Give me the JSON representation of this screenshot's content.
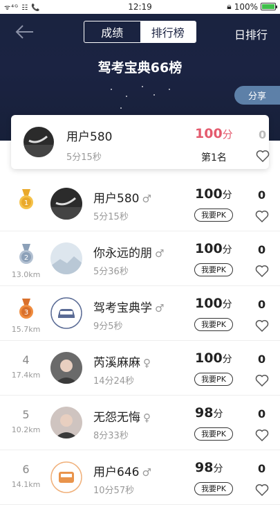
{
  "status_bar": {
    "left": "ᯤ⁴ᴳ ☷ 📞",
    "time": "12:19",
    "battery": "100%"
  },
  "header": {
    "tabs": [
      "成绩",
      "排行榜"
    ],
    "active_tab": 1,
    "daily_label": "日排行"
  },
  "hero": {
    "title": "驾考宝典66榜",
    "share_label": "分享"
  },
  "my_card": {
    "name": "用户580",
    "time": "5分15秒",
    "score": "100",
    "score_unit": "分",
    "rank": "第1名",
    "likes": "0"
  },
  "rows": [
    {
      "rank": "",
      "medal": "gold",
      "distance": "",
      "name": "用户580",
      "sex": "♂",
      "time": "5分15秒",
      "score": "100",
      "unit": "分",
      "pk": "我要PK",
      "likes": "0",
      "avatar": "dark-photo"
    },
    {
      "rank": "",
      "medal": "silver",
      "distance": "13.0km",
      "name": "你永远的朋",
      "sex": "♂",
      "time": "5分36秒",
      "score": "100",
      "unit": "分",
      "pk": "我要PK",
      "likes": "0",
      "avatar": "snow"
    },
    {
      "rank": "",
      "medal": "bronze",
      "distance": "15.7km",
      "name": "驾考宝典学",
      "sex": "♂",
      "time": "9分5秒",
      "score": "100",
      "unit": "分",
      "pk": "我要PK",
      "likes": "0",
      "avatar": "car"
    },
    {
      "rank": "4",
      "medal": "",
      "distance": "17.4km",
      "name": "芮溪麻麻",
      "sex": "♀",
      "time": "14分24秒",
      "score": "100",
      "unit": "分",
      "pk": "我要PK",
      "likes": "0",
      "avatar": "portrait"
    },
    {
      "rank": "5",
      "medal": "",
      "distance": "10.2km",
      "name": "无怨无悔",
      "sex": "♀",
      "time": "8分33秒",
      "score": "98",
      "unit": "分",
      "pk": "我要PK",
      "likes": "0",
      "avatar": "portrait2"
    },
    {
      "rank": "6",
      "medal": "",
      "distance": "14.1km",
      "name": "用户646",
      "sex": "♂",
      "time": "10分57秒",
      "score": "98",
      "unit": "分",
      "pk": "我要PK",
      "likes": "0",
      "avatar": "car-orange"
    }
  ],
  "colors": {
    "header_bg": "#1b2342",
    "score_red": "#e45b6e",
    "share_btn": "#5d80a8"
  }
}
